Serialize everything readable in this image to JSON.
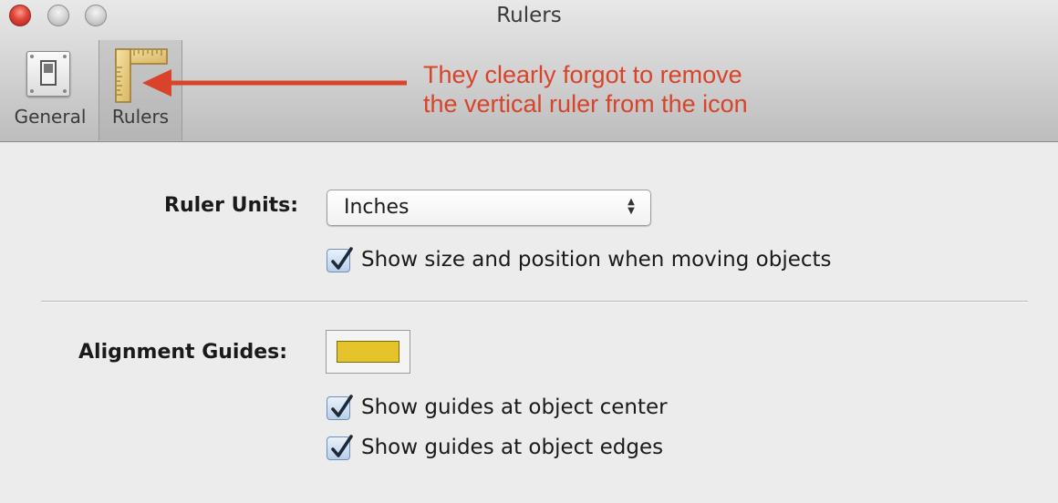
{
  "window": {
    "title": "Rulers"
  },
  "toolbar": {
    "items": [
      {
        "label": "General",
        "icon": "general-switch-icon"
      },
      {
        "label": "Rulers",
        "icon": "ruler-icon"
      }
    ]
  },
  "annotation": {
    "line1": "They clearly forgot to remove",
    "line2": "the vertical ruler from the icon",
    "color": "#d8432a"
  },
  "ruler_units": {
    "label": "Ruler Units:",
    "value": "Inches"
  },
  "checkboxes": {
    "show_size_position": {
      "label": "Show size and position when moving objects",
      "checked": true
    },
    "show_center": {
      "label": "Show guides at object center",
      "checked": true
    },
    "show_edges": {
      "label": "Show guides at object edges",
      "checked": true
    }
  },
  "alignment_guides": {
    "label": "Alignment Guides:",
    "color": "#e4c42a"
  }
}
